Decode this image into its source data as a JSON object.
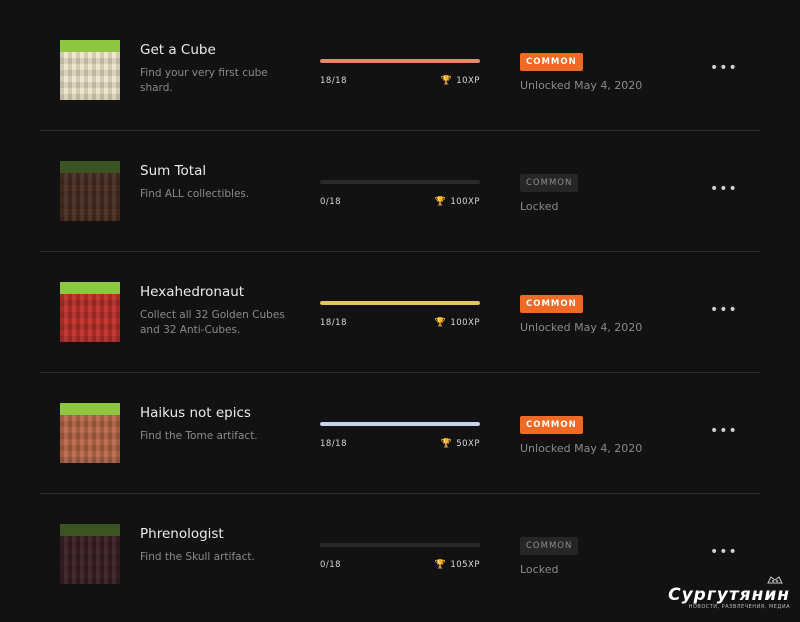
{
  "achievements": [
    {
      "title": "Get a Cube",
      "description": "Find your very first cube shard.",
      "progress_text": "18/18",
      "progress": 1.0,
      "bar_color": "#e28b6c",
      "xp": "10XP",
      "trophy_color": "#c8774a",
      "rarity": "COMMON",
      "unlocked": true,
      "status": "Unlocked May 4, 2020",
      "grass_color": "#8dc63f",
      "body_color": "#efe6cc",
      "more": "•••"
    },
    {
      "title": "Sum Total",
      "description": "Find ALL collectibles.",
      "progress_text": "0/18",
      "progress": 0.0,
      "bar_color": "#2a2a2a",
      "xp": "100XP",
      "trophy_color": "#e2a52b",
      "rarity": "COMMON",
      "unlocked": false,
      "status": "Locked",
      "grass_color": "#3c5322",
      "body_color": "#4a2e22",
      "more": "•••"
    },
    {
      "title": "Hexahedronaut",
      "description": "Collect all 32 Golden Cubes and 32 Anti-Cubes.",
      "progress_text": "18/18",
      "progress": 1.0,
      "bar_color": "#e7c46a",
      "xp": "100XP",
      "trophy_color": "#e2a52b",
      "rarity": "COMMON",
      "unlocked": true,
      "status": "Unlocked May 4, 2020",
      "grass_color": "#8dc63f",
      "body_color": "#c0302a",
      "more": "•••"
    },
    {
      "title": "Haikus not epics",
      "description": "Find the Tome artifact.",
      "progress_text": "18/18",
      "progress": 1.0,
      "bar_color": "#c6d6ea",
      "xp": "50XP",
      "trophy_color": "#b8c8dc",
      "rarity": "COMMON",
      "unlocked": true,
      "status": "Unlocked May 4, 2020",
      "grass_color": "#8dc63f",
      "body_color": "#b8684a",
      "more": "•••"
    },
    {
      "title": "Phrenologist",
      "description": "Find the Skull artifact.",
      "progress_text": "0/18",
      "progress": 0.0,
      "bar_color": "#2a2a2a",
      "xp": "105XP",
      "trophy_color": "#e2a52b",
      "rarity": "COMMON",
      "unlocked": false,
      "status": "Locked",
      "grass_color": "#3c5322",
      "body_color": "#3a1f26",
      "more": "•••"
    }
  ],
  "watermark": {
    "name": "Сургутянин",
    "tagline": "НОВОСТИ, РАЗВЛЕЧЕНИЯ, МЕДИА"
  }
}
